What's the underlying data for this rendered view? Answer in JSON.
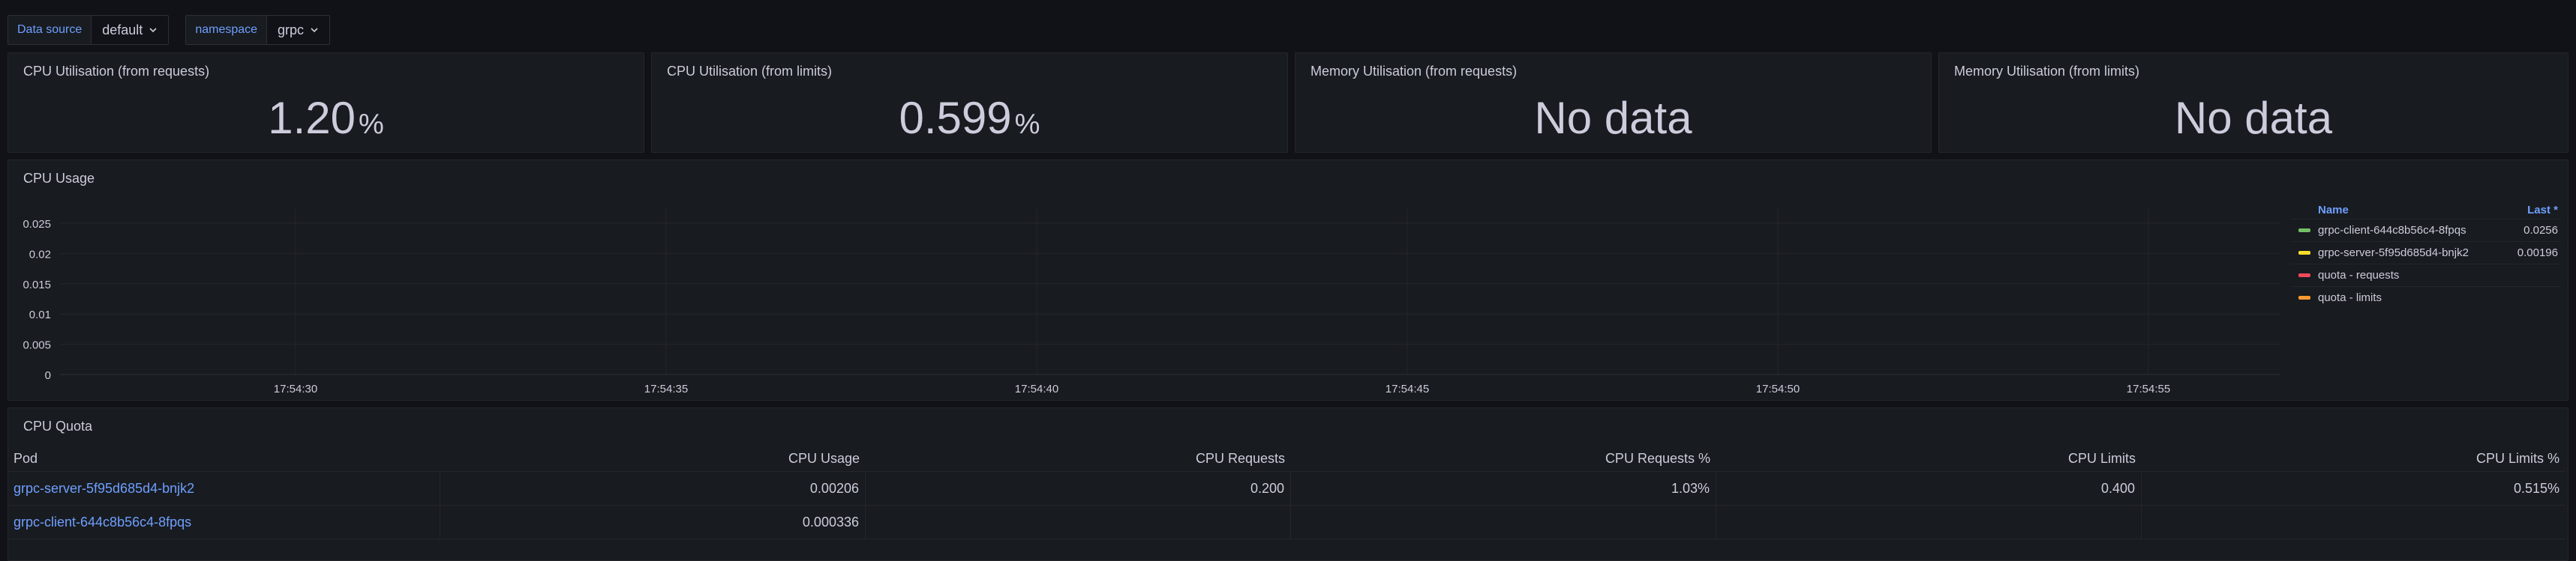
{
  "variables": [
    {
      "label": "Data source",
      "value": "default"
    },
    {
      "label": "namespace",
      "value": "grpc"
    }
  ],
  "stats": [
    {
      "title": "CPU Utilisation (from requests)",
      "value": "1.20",
      "unit": "%"
    },
    {
      "title": "CPU Utilisation (from limits)",
      "value": "0.599",
      "unit": "%"
    },
    {
      "title": "Memory Utilisation (from requests)",
      "value": "No data",
      "unit": ""
    },
    {
      "title": "Memory Utilisation (from limits)",
      "value": "No data",
      "unit": ""
    }
  ],
  "cpu_usage": {
    "title": "CPU Usage",
    "legend": {
      "name_header": "Name",
      "last_header": "Last *",
      "items": [
        {
          "name": "grpc-client-644c8b56c4-8fpqs",
          "last": "0.0256",
          "color": "#73bf69"
        },
        {
          "name": "grpc-server-5f95d685d4-bnjk2",
          "last": "0.00196",
          "color": "#fade2a"
        },
        {
          "name": "quota - requests",
          "last": "",
          "color": "#f2495c"
        },
        {
          "name": "quota - limits",
          "last": "",
          "color": "#ff9830"
        }
      ]
    }
  },
  "chart_data": {
    "type": "line",
    "title": "CPU Usage",
    "x_ticks": [
      "17:54:30",
      "17:54:35",
      "17:54:40",
      "17:54:45",
      "17:54:50",
      "17:54:55"
    ],
    "y_ticks": [
      "0",
      "0.005",
      "0.01",
      "0.015",
      "0.02",
      "0.025"
    ],
    "ylim": [
      0,
      0.025
    ],
    "series": [
      {
        "name": "grpc-client-644c8b56c4-8fpqs",
        "values": []
      },
      {
        "name": "grpc-server-5f95d685d4-bnjk2",
        "values": []
      },
      {
        "name": "quota - requests",
        "values": []
      },
      {
        "name": "quota - limits",
        "values": []
      }
    ],
    "grid": true,
    "legend_position": "right"
  },
  "cpu_quota": {
    "title": "CPU Quota",
    "headers": [
      "Pod",
      "CPU Usage",
      "CPU Requests",
      "CPU Requests %",
      "CPU Limits",
      "CPU Limits %"
    ],
    "rows": [
      [
        "grpc-server-5f95d685d4-bnjk2",
        "0.00206",
        "0.200",
        "1.03%",
        "0.400",
        "0.515%"
      ],
      [
        "grpc-client-644c8b56c4-8fpqs",
        "0.000336",
        "",
        "",
        "",
        ""
      ]
    ]
  },
  "colors": {
    "background": "#111217",
    "panel": "#181b1f",
    "link": "#6e9fff",
    "text": "#ccccdc"
  }
}
